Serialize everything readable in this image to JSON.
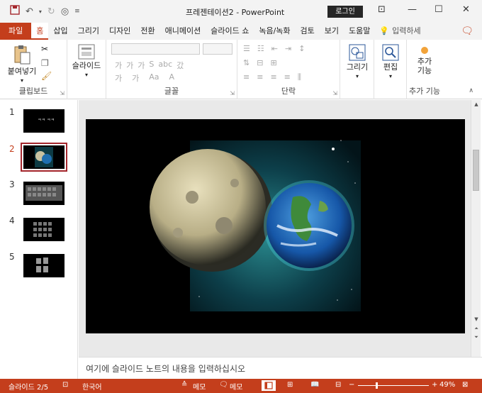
{
  "titlebar": {
    "title": "프레젠테이션2  -  PowerPoint",
    "login": "로그인"
  },
  "tabs": [
    "파일",
    "홈",
    "삽입",
    "그리기",
    "디자인",
    "전환",
    "애니메이션",
    "슬라이드 쇼",
    "녹음/녹화",
    "검토",
    "보기",
    "도움말"
  ],
  "tell_me": "입력하세",
  "ribbon": {
    "clipboard": {
      "label": "클립보드",
      "paste": "붙여넣기"
    },
    "slides": {
      "label": "",
      "new_slide": "슬라이드"
    },
    "font": {
      "label": "글꼴",
      "row1": [
        "가",
        "가",
        "가",
        "S",
        "abc",
        "갔"
      ],
      "row2": [
        "가",
        "가",
        "Aa",
        "A"
      ]
    },
    "paragraph": {
      "label": "단락"
    },
    "drawing": {
      "label": "",
      "btn": "그리기"
    },
    "editing": {
      "label": "",
      "btn": "편집"
    },
    "addins": {
      "label": "추가 기능",
      "btn_line1": "추가",
      "btn_line2": "기능"
    }
  },
  "slides_panel": {
    "selected_index": 2,
    "items": [
      {
        "number": "1",
        "thumb_text": "ㅋㅋ ㅋㅋ"
      },
      {
        "number": "2",
        "thumb_text": ""
      },
      {
        "number": "3",
        "thumb_text": ""
      },
      {
        "number": "4",
        "thumb_text": ""
      },
      {
        "number": "5",
        "thumb_text": ""
      }
    ]
  },
  "notes": {
    "placeholder": "여기에 슬라이드 노트의 내용을 입력하십시오"
  },
  "status": {
    "slide_info": "슬라이드 2/5",
    "language": "한국어",
    "notes1": "메모",
    "notes2": "메모",
    "zoom": "49%"
  },
  "colors": {
    "accent": "#c43e1c",
    "slide_bg": "#000000"
  }
}
